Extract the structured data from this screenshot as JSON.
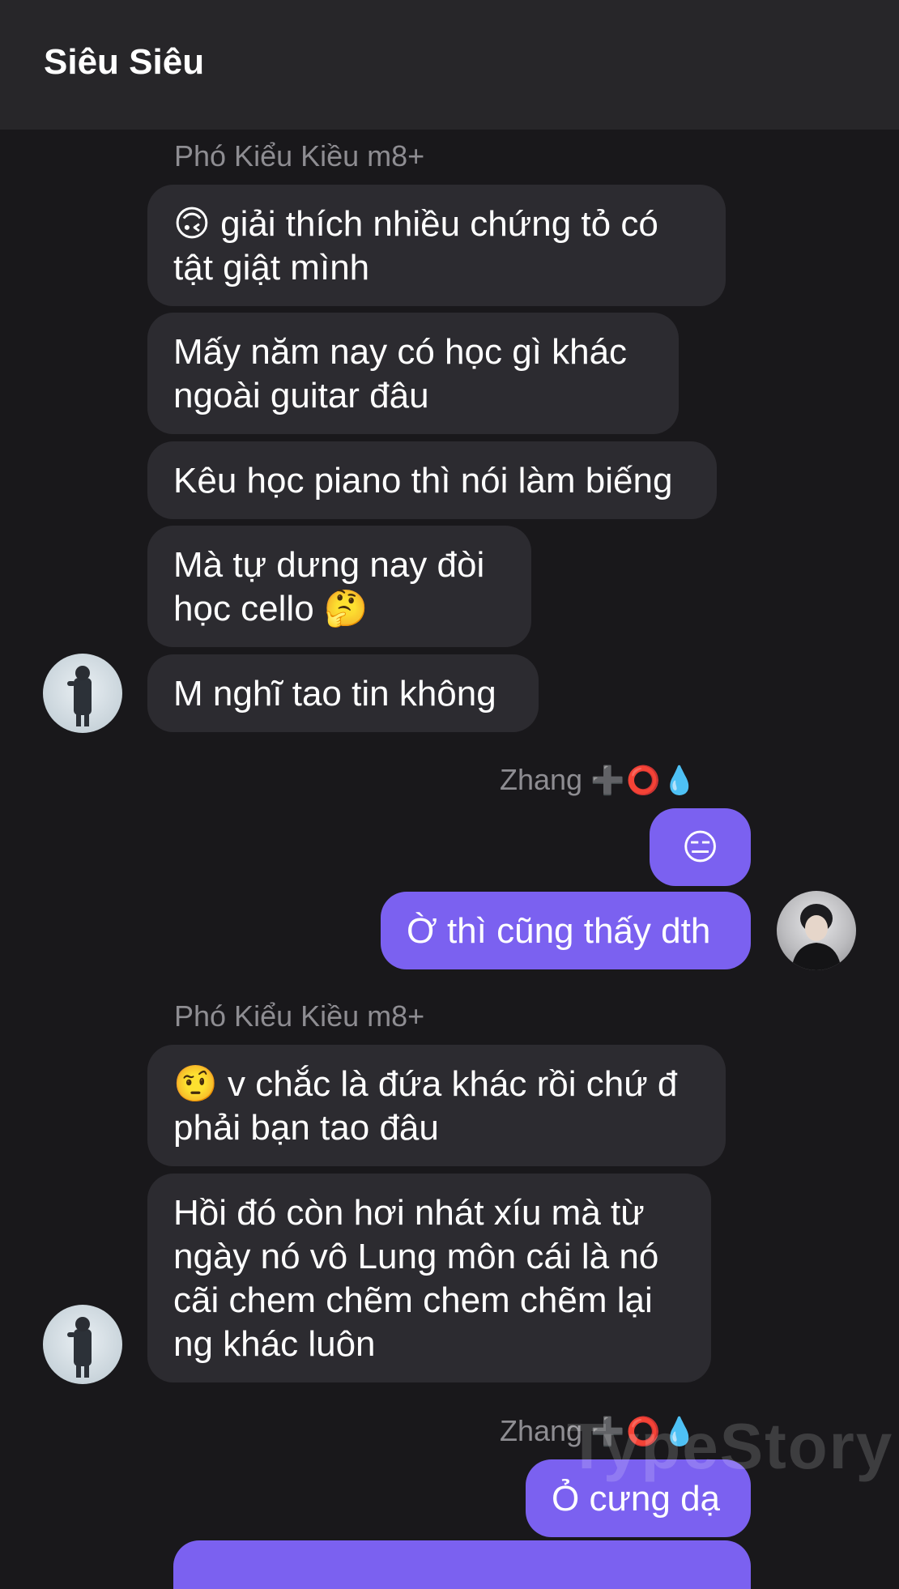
{
  "header": {
    "title": "Siêu Siêu"
  },
  "messages": [
    {
      "sender": "Phó Kiểu Kiều m8+"
    },
    {
      "text": "🙃 giải thích nhiều chứng tỏ có\ntật giật mình"
    },
    {
      "text": "Mấy năm nay có học gì khác\nngoài guitar đâu"
    },
    {
      "text": "Kêu học piano thì nói làm biếng"
    },
    {
      "text": "Mà tự dưng nay đòi\nhọc cello 🤔"
    },
    {
      "text": "M nghĩ tao tin không"
    },
    {
      "sender": "Zhang",
      "sender_marks": "➕⭕💧"
    },
    {
      "text": "😑"
    },
    {
      "text": "Ờ thì cũng thấy dth"
    },
    {
      "sender": "Phó Kiểu Kiều m8+"
    },
    {
      "text": "🤨 v chắc là đứa khác rồi chứ đ\nphải bạn tao đâu"
    },
    {
      "text": "Hồi đó còn hơi nhát xíu mà từ\nngày nó vô Lung môn cái là nó\ncãi chem chẽm chem chẽm lại\nng khác luôn"
    },
    {
      "sender": "Zhang",
      "sender_marks": "➕⭕💧"
    },
    {
      "text": "Ỏ cưng dạ"
    }
  ],
  "watermark": "TypeStory",
  "colors": {
    "background": "#19181b",
    "header": "#272629",
    "incoming_bubble": "#2c2b30",
    "outgoing_bubble": "#7b61f0",
    "sender_name": "#8e8d92"
  },
  "icons": [
    "avatar-photo"
  ]
}
